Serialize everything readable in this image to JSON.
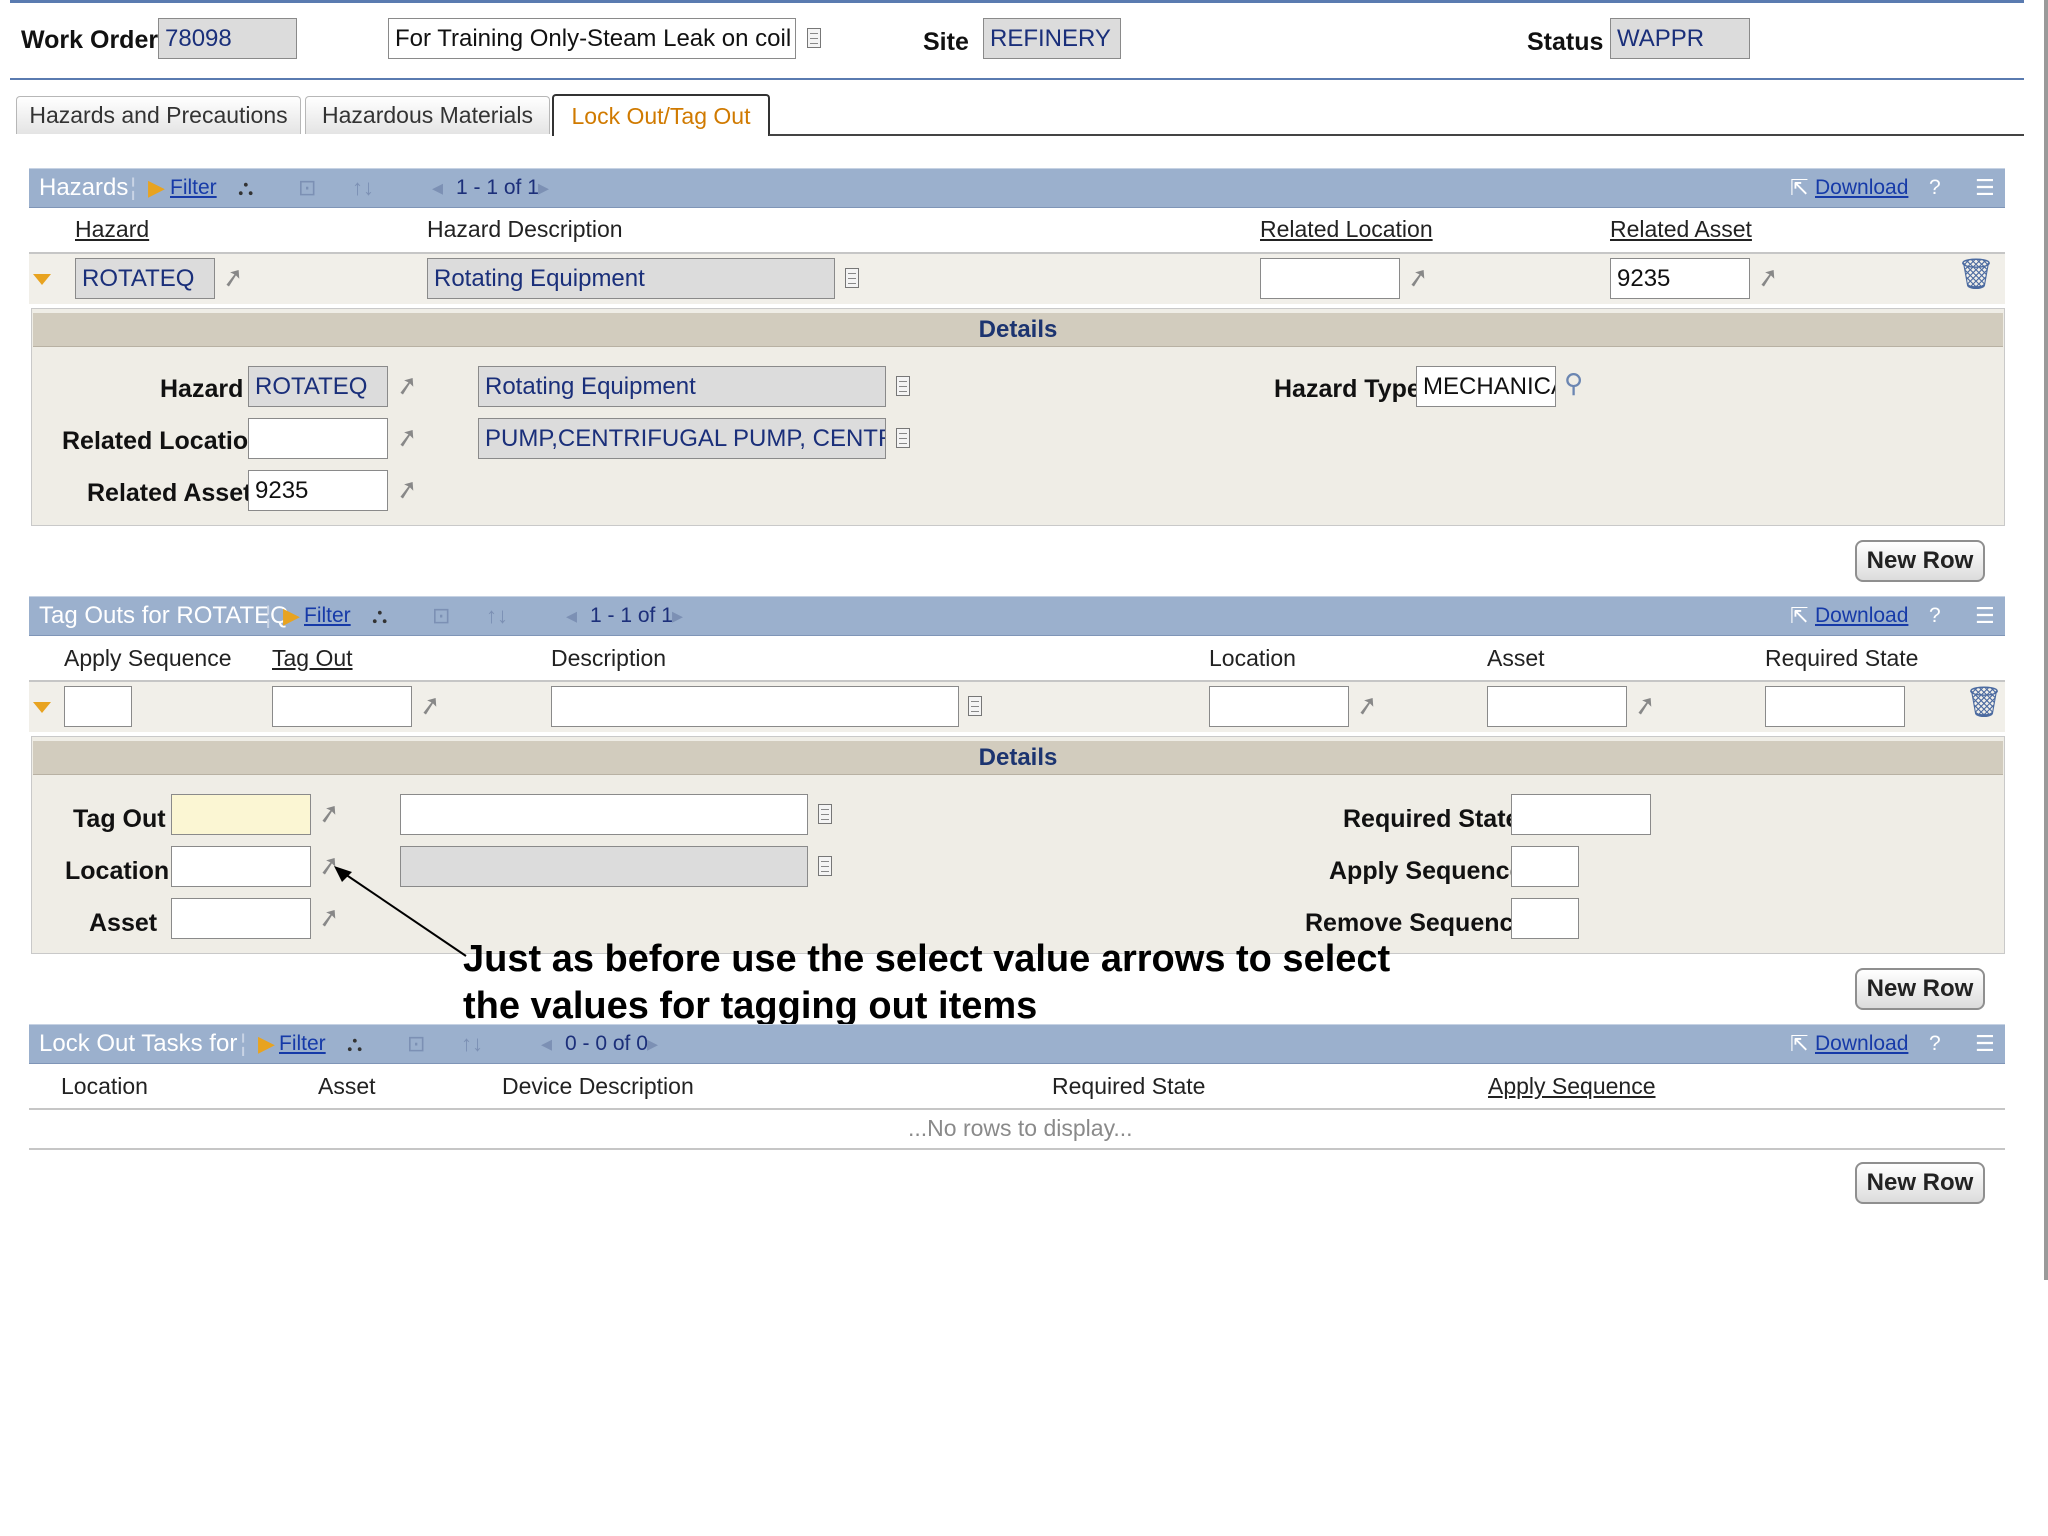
{
  "header": {
    "work_order_label": "Work Order",
    "work_order_value": "78098",
    "description_value": "For Training Only-Steam Leak on coil",
    "site_label": "Site",
    "site_value": "REFINERY",
    "status_label": "Status",
    "status_value": "WAPPR"
  },
  "tabs": [
    {
      "label": "Hazards and Precautions"
    },
    {
      "label": "Hazardous Materials"
    },
    {
      "label": "Lock Out/Tag Out"
    }
  ],
  "hazards": {
    "title": "Hazards",
    "filter_label": "Filter",
    "pagination": "1 - 1 of 1",
    "download_label": "Download",
    "help_label": "?",
    "columns": [
      "Hazard",
      "Hazard Description",
      "Related Location",
      "Related Asset"
    ],
    "row": {
      "hazard": "ROTATEQ",
      "description": "Rotating Equipment",
      "related_location": "",
      "related_asset": "9235"
    },
    "details": {
      "title": "Details",
      "hazard_label": "Hazard",
      "hazard_value": "ROTATEQ",
      "hazard_desc": "Rotating Equipment",
      "related_location_label": "Related Location",
      "related_location_value": "",
      "location_desc": "PUMP,CENTRIFUGAL PUMP, CENTRIFUGAL",
      "related_asset_label": "Related Asset",
      "related_asset_value": "9235",
      "hazard_type_label": "Hazard Type",
      "hazard_type_value": "MECHANICAL"
    },
    "new_row_label": "New Row"
  },
  "tagouts": {
    "title": "Tag Outs for ROTATEQ",
    "filter_label": "Filter",
    "pagination": "1 - 1 of 1",
    "download_label": "Download",
    "help_label": "?",
    "columns": [
      "Apply Sequence",
      "Tag Out",
      "Description",
      "Location",
      "Asset",
      "Required State"
    ],
    "details": {
      "title": "Details",
      "tag_out_label": "Tag Out",
      "location_label": "Location",
      "asset_label": "Asset",
      "required_state_label": "Required State",
      "apply_sequence_label": "Apply Sequence",
      "remove_sequence_label": "Remove Sequence"
    },
    "new_row_label": "New Row"
  },
  "lockout": {
    "title": "Lock Out Tasks for",
    "filter_label": "Filter",
    "pagination": "0 - 0 of 0",
    "download_label": "Download",
    "help_label": "?",
    "columns": [
      "Location",
      "Asset",
      "Device Description",
      "Required State",
      "Apply Sequence"
    ],
    "empty_message": "...No rows to display...",
    "new_row_label": "New Row"
  },
  "annotation": {
    "line1": "Just as before use the select value arrows to select",
    "line2": "the values for tagging out items"
  },
  "icons": {
    "filter": "filter-arrow-icon",
    "find": "binoculars-icon",
    "clear": "clear-filter-icon",
    "sort": "sort-arrows-icon",
    "prev": "previous-page-icon",
    "next": "next-page-icon",
    "select_value": "select-value-arrow-icon",
    "long_description": "long-description-icon",
    "detail_menu": "detail-menu-icon",
    "delete": "trash-icon"
  },
  "colors": {
    "section_bar": "#9bb0cd",
    "active_tab_text": "#d07a00",
    "readonly_field": "#dcdcdc",
    "required_field": "#fbf6d3",
    "details_panel": "#efede6",
    "link": "#163aa8"
  }
}
